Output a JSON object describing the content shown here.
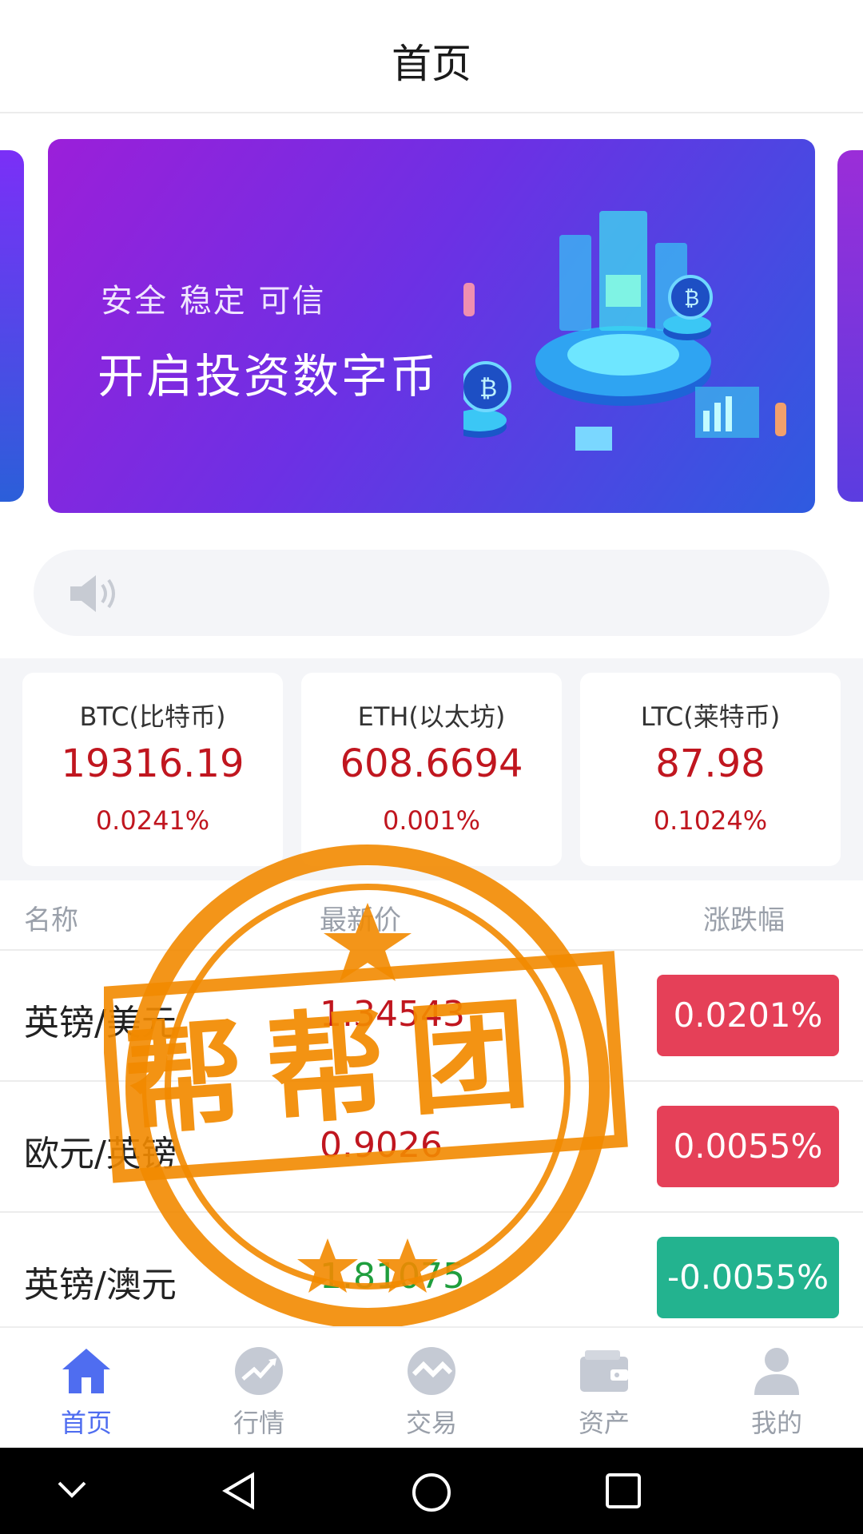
{
  "header": {
    "title": "首页"
  },
  "banner": {
    "tagline": "安全 稳定 可信",
    "headline": "开启投资数字币"
  },
  "notice": {
    "icon": "speaker-icon",
    "text": ""
  },
  "quotes": [
    {
      "name": "BTC(比特币)",
      "price": "19316.19",
      "change": "0.0241%"
    },
    {
      "name": "ETH(以太坊)",
      "price": "608.6694",
      "change": "0.001%"
    },
    {
      "name": "LTC(莱特币)",
      "price": "87.98",
      "change": "0.1024%"
    }
  ],
  "list": {
    "headers": {
      "name": "名称",
      "price": "最新价",
      "change": "涨跌幅"
    },
    "rows": [
      {
        "pair": "英镑/美元",
        "price": "1.34543",
        "change": "0.0201%",
        "direction": "up"
      },
      {
        "pair": "欧元/英镑",
        "price": "0.9026",
        "change": "0.0055%",
        "direction": "up"
      },
      {
        "pair": "英镑/澳元",
        "price": "1.81075",
        "change": "-0.0055%",
        "direction": "down"
      }
    ]
  },
  "watermark": {
    "text": "帮帮团",
    "color": "#f28a00"
  },
  "tabs": [
    {
      "label": "首页",
      "icon": "home-icon",
      "active": true
    },
    {
      "label": "行情",
      "icon": "trend-icon",
      "active": false
    },
    {
      "label": "交易",
      "icon": "exchange-icon",
      "active": false
    },
    {
      "label": "资产",
      "icon": "wallet-icon",
      "active": false
    },
    {
      "label": "我的",
      "icon": "user-icon",
      "active": false
    }
  ],
  "colors": {
    "accent": "#4f6df0",
    "rise": "#c0161f",
    "rise_badge": "#e54058",
    "fall": "#1f9e3d",
    "fall_badge": "#23b38f"
  }
}
